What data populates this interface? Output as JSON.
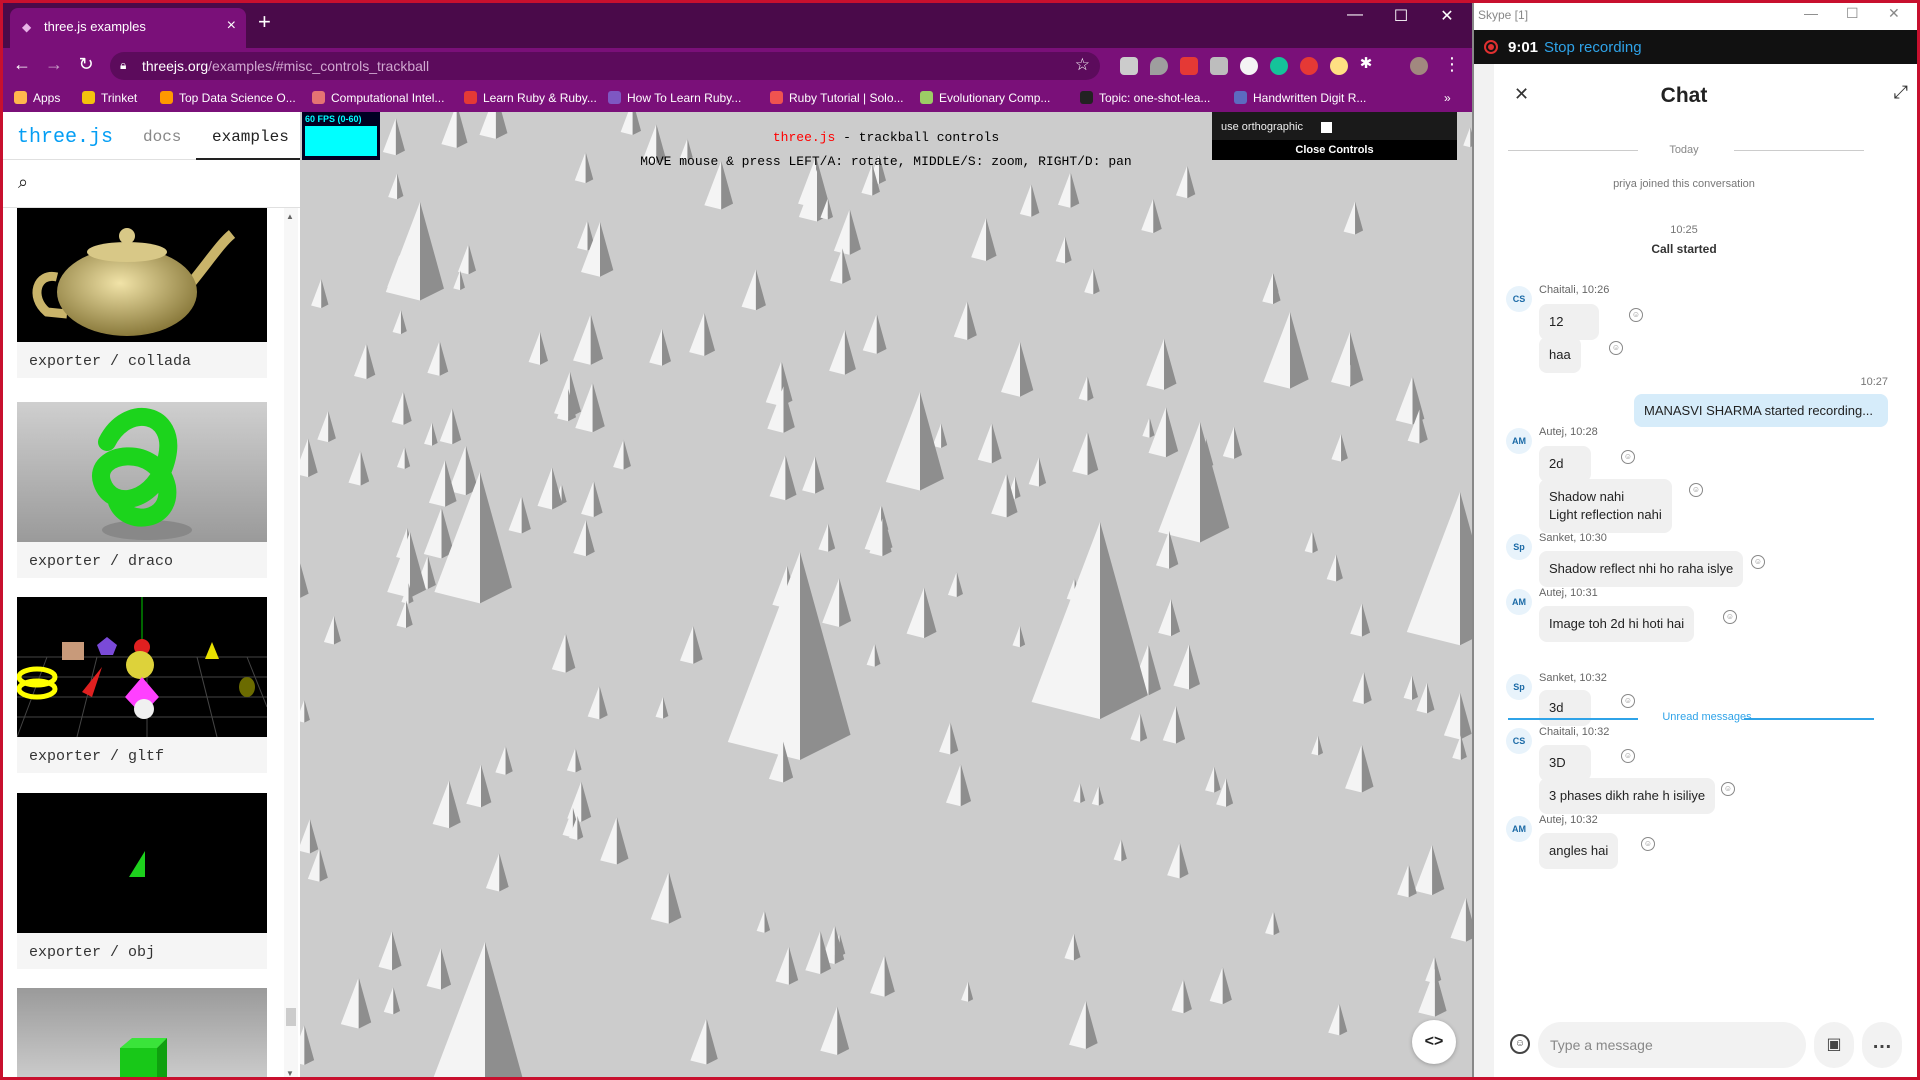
{
  "browser": {
    "tab_title": "three.js examples",
    "tab_close": "×",
    "new_tab": "+",
    "url_host": "threejs.org",
    "url_path": "/examples/#misc_controls_trackball",
    "bookmarks": [
      {
        "label": "Apps",
        "color": "#ffb74d"
      },
      {
        "label": "Trinket",
        "color": "#f4c20d"
      },
      {
        "label": "Top Data Science O...",
        "color": "#ff9800"
      },
      {
        "label": "Computational Intel...",
        "color": "#e57373"
      },
      {
        "label": "Learn Ruby & Ruby...",
        "color": "#e53935"
      },
      {
        "label": "How To Learn Ruby...",
        "color": "#7e57c2"
      },
      {
        "label": "Ruby Tutorial | Solo...",
        "color": "#ef5350"
      },
      {
        "label": "Evolutionary Comp...",
        "color": "#9ccc65"
      },
      {
        "label": "Topic: one-shot-lea...",
        "color": "#222222"
      },
      {
        "label": "Handwritten Digit R...",
        "color": "#5c6bc0"
      }
    ],
    "more_bookmarks": "»"
  },
  "sidebar": {
    "logo": "three.js",
    "tab_docs": "docs",
    "tab_examples": "examples",
    "examples": [
      {
        "label": "exporter / collada"
      },
      {
        "label": "exporter / draco"
      },
      {
        "label": "exporter / gltf"
      },
      {
        "label": "exporter / obj"
      }
    ]
  },
  "viewport": {
    "stats": "60 FPS (0-60)",
    "info_link": "three.js",
    "info_title": " - trackball controls",
    "info_help": "MOVE mouse & press LEFT/A: rotate, MIDDLE/S: zoom, RIGHT/D: pan",
    "gui_label": "use orthographic",
    "gui_close": "Close Controls",
    "code_button": "<>",
    "background": "#cccccc"
  },
  "skype": {
    "window_title": "Skype [1]",
    "rec_time": "9:01",
    "rec_stop": "Stop recording",
    "chat_title": "Chat",
    "today": "Today",
    "joined": "priya joined this conversation",
    "call_time": "10:25",
    "call_started": "Call started",
    "my_time": "10:27",
    "my_message": "MANASVI SHARMA started recording...",
    "unread": "Unread messages",
    "placeholder": "Type a message",
    "groups": [
      {
        "initials": "CS",
        "sender": "Chaitali, 10:26",
        "messages": [
          "12",
          "haa"
        ]
      },
      {
        "initials": "AM",
        "sender": "Autej, 10:28",
        "messages": [
          "2d",
          "Shadow nahi\nLight reflection nahi"
        ]
      },
      {
        "initials": "Sp",
        "sender": "Sanket, 10:30",
        "messages": [
          "Shadow reflect nhi ho raha islye"
        ]
      },
      {
        "initials": "AM",
        "sender": "Autej, 10:31",
        "messages": [
          "Image toh 2d hi hoti hai"
        ]
      },
      {
        "initials": "Sp",
        "sender": "Sanket, 10:32",
        "messages": [
          "3d"
        ]
      },
      {
        "initials": "CS",
        "sender": "Chaitali, 10:32",
        "messages": [
          "3D",
          "3 phases dikh rahe h isiliye"
        ]
      },
      {
        "initials": "AM",
        "sender": "Autej, 10:32",
        "messages": [
          "angles hai"
        ]
      }
    ]
  }
}
